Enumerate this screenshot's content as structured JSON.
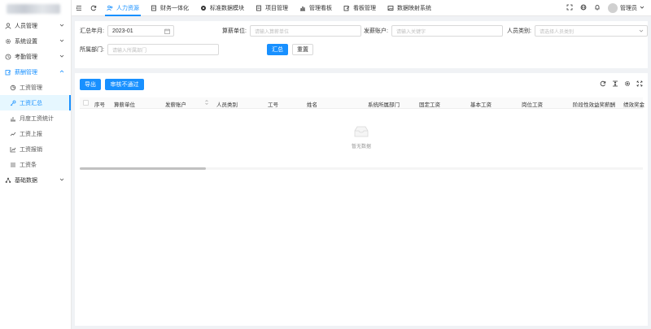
{
  "sidebar": {
    "items": [
      {
        "label": "人员管理",
        "icon": "user-icon"
      },
      {
        "label": "系统设置",
        "icon": "gear-icon"
      },
      {
        "label": "考勤管理",
        "icon": "clock-icon"
      },
      {
        "label": "薪酬管理",
        "icon": "edit-icon"
      }
    ],
    "subitems": [
      {
        "label": "工资管理",
        "icon": "pie-icon"
      },
      {
        "label": "工资汇总",
        "icon": "key-icon"
      },
      {
        "label": "月度工资统计",
        "icon": "stats-icon"
      },
      {
        "label": "工资上报",
        "icon": "upload-icon"
      },
      {
        "label": "工资报销",
        "icon": "chart-icon"
      },
      {
        "label": "工资条",
        "icon": "list-icon"
      }
    ],
    "bottom": {
      "label": "基础数据",
      "icon": "cluster-icon"
    }
  },
  "topbar": {
    "tabs": [
      {
        "label": "人力资源"
      },
      {
        "label": "财务一体化"
      },
      {
        "label": "标准数据模块"
      },
      {
        "label": "项目管理"
      },
      {
        "label": "管理看板"
      },
      {
        "label": "看板管理"
      },
      {
        "label": "数据映射系统"
      }
    ],
    "user": "管理员"
  },
  "search": {
    "month_label": "汇总年月:",
    "month_value": "2023-01",
    "unit_label": "算薪单位:",
    "unit_placeholder": "请输入算薪单位",
    "account_label": "发薪账户:",
    "account_placeholder": "请输入关键字",
    "type_label": "人员类别:",
    "type_placeholder": "请选择人员类别",
    "dept_label": "所属部门:",
    "dept_placeholder": "请输入所属部门",
    "submit": "汇总",
    "reset": "重置"
  },
  "table": {
    "export": "导出",
    "reject": "审核不通过",
    "columns": [
      "序号",
      "算薪单位",
      "发薪账户",
      "人员类别",
      "工号",
      "姓名",
      "系统所属部门",
      "固定工资",
      "基本工资",
      "岗位工资",
      "阶段性效益奖薪酬",
      "绩效奖金"
    ],
    "empty": "暂无数据"
  },
  "colors": {
    "primary": "#1890ff"
  }
}
